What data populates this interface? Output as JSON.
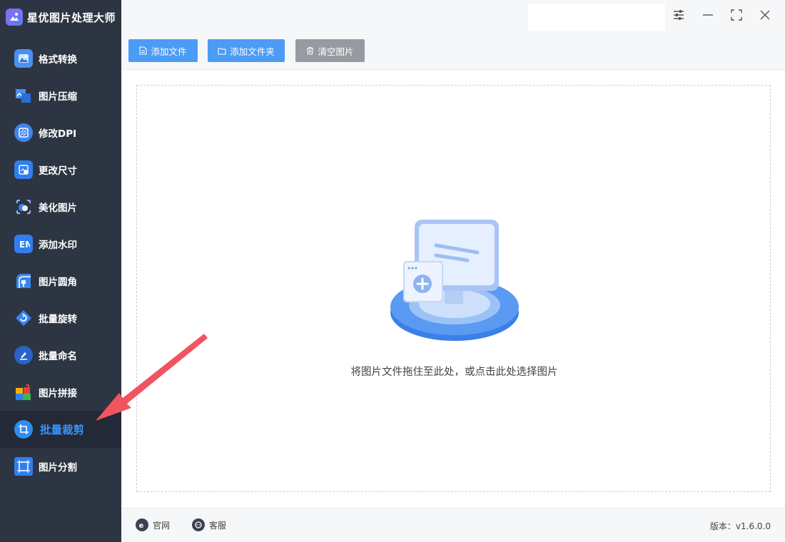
{
  "app": {
    "title": "星优图片处理大师"
  },
  "colors": {
    "sidebar_bg": "#2e3542",
    "active_bg": "#232936",
    "accent": "#3d8ff5",
    "button_blue": "#4b9cf5",
    "button_gray": "#969aa1",
    "annotation_arrow": "#f0555f"
  },
  "sidebar": {
    "items": [
      {
        "label": "格式转换",
        "icon": "format-convert-icon"
      },
      {
        "label": "图片压缩",
        "icon": "image-compress-icon"
      },
      {
        "label": "修改DPI",
        "icon": "dpi-icon"
      },
      {
        "label": "更改尺寸",
        "icon": "resize-icon"
      },
      {
        "label": "美化图片",
        "icon": "beautify-icon"
      },
      {
        "label": "添加水印",
        "icon": "watermark-icon"
      },
      {
        "label": "图片圆角",
        "icon": "round-corner-icon"
      },
      {
        "label": "批量旋转",
        "icon": "rotate-icon"
      },
      {
        "label": "批量命名",
        "icon": "rename-icon"
      },
      {
        "label": "图片拼接",
        "icon": "stitch-icon"
      },
      {
        "label": "批量裁剪",
        "icon": "crop-icon",
        "active": true
      },
      {
        "label": "图片分割",
        "icon": "split-icon"
      }
    ]
  },
  "topbar": {
    "search_value": ""
  },
  "toolbar": {
    "add_file": "添加文件",
    "add_folder": "添加文件夹",
    "clear_images": "清空图片"
  },
  "dropzone": {
    "hint": "将图片文件拖住至此处，或点击此处选择图片"
  },
  "footer": {
    "website": "官网",
    "support": "客服",
    "version": "版本：v1.6.0.0"
  }
}
